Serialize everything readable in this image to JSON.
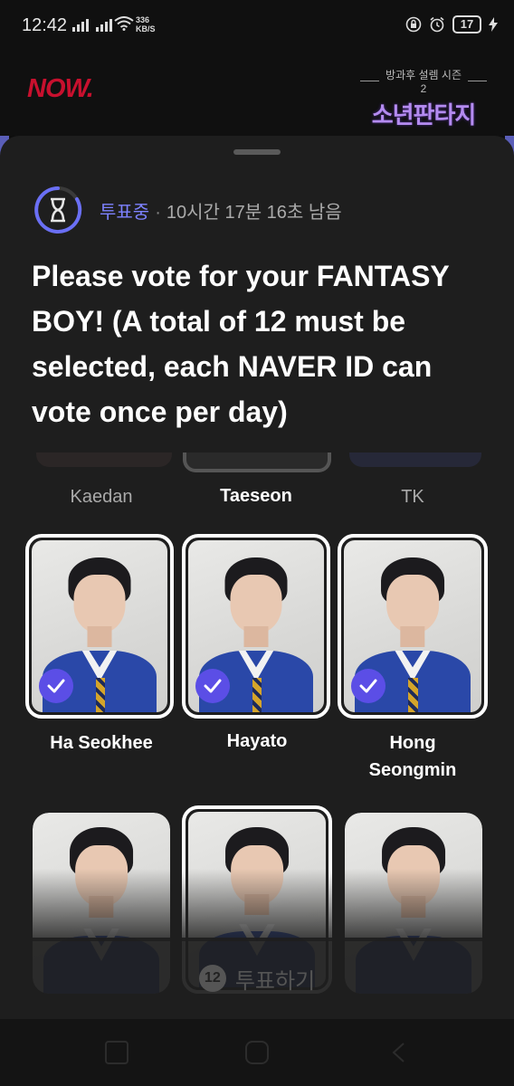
{
  "status_bar": {
    "time": "12:42",
    "net_speed_value": "336",
    "net_speed_unit": "KB/S",
    "battery": "17"
  },
  "app_header": {
    "brand": "NOW.",
    "show_subtitle": "방과후 설렘 시즌2",
    "show_title": "소년판타지"
  },
  "vote": {
    "status_label": "투표중",
    "separator": "·",
    "remaining": "10시간 17분 16초 남음",
    "title": "Please vote for your FANTASY BOY! (A total of 12 must be selected, each NAVER ID can vote once per day)"
  },
  "contestants": [
    {
      "name": "Kaedan",
      "selected": false
    },
    {
      "name": "Taeseon",
      "selected": true
    },
    {
      "name": "TK",
      "selected": false
    },
    {
      "name": "Ha Seokhee",
      "selected": true
    },
    {
      "name": "Hayato",
      "selected": true
    },
    {
      "name": "Hong Seongmin",
      "selected": true
    },
    {
      "name": "",
      "selected": false
    },
    {
      "name": "",
      "selected": true
    },
    {
      "name": "",
      "selected": false
    }
  ],
  "vote_button": {
    "count": "12",
    "label": "투표하기"
  },
  "colors": {
    "accent": "#7d82ff",
    "check": "#5b4ee6",
    "brand_red": "#c8102e",
    "jacket_blue": "#2a48a8"
  }
}
